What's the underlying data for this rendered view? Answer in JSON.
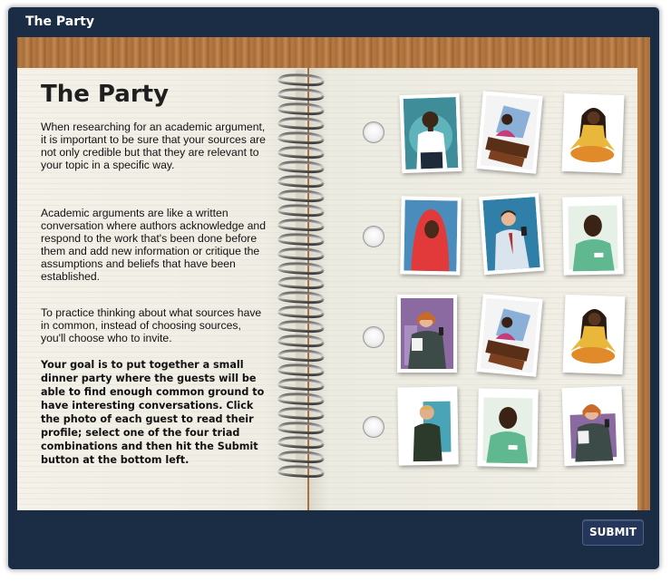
{
  "window": {
    "title": "The Party"
  },
  "left_page": {
    "heading": "The Party",
    "paragraph1": "When researching for an academic argument, it is important to be sure that your sources are not only credible but that they are relevant to your topic in a specific way.",
    "paragraph2": "Academic arguments are like a written conversation where authors acknowledge and respond to the work that's been done before them and add new information or critique the assumptions and beliefs that have been established.",
    "paragraph3": "To practice thinking about what sources have in common, instead of choosing sources, you'll choose who to invite.",
    "paragraph4": "Your goal is to put together a small dinner party where the guests will be able to find enough common ground to have interesting conversations. Click the photo of each guest to read their profile; select one of the four triad combinations and then hit the Submit button at the bottom left."
  },
  "triads": [
    {
      "selected": false,
      "guests": [
        "man-white-shirt-icon",
        "woman-at-desk-icon",
        "woman-meditating-icon"
      ]
    },
    {
      "selected": false,
      "guests": [
        "woman-red-hijab-icon",
        "man-with-phone-icon",
        "man-green-shirt-icon"
      ]
    },
    {
      "selected": false,
      "guests": [
        "businesswoman-phone-icon",
        "woman-at-desk-icon",
        "woman-meditating-icon"
      ]
    },
    {
      "selected": false,
      "guests": [
        "man-dark-jacket-icon",
        "man-green-shirt-icon",
        "businesswoman-phone-icon"
      ]
    }
  ],
  "footer": {
    "submit_label": "SUBMIT"
  }
}
